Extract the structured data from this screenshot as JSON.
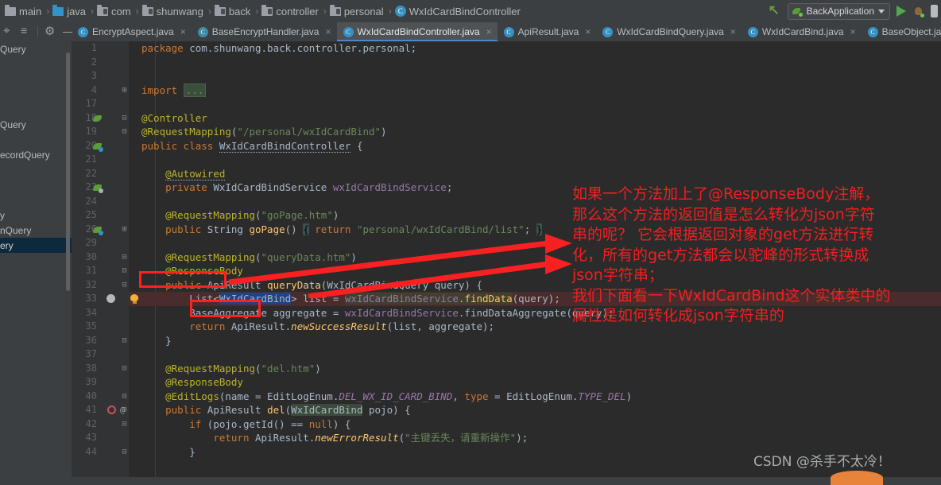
{
  "window": {
    "breadcrumb": [
      {
        "label": "main",
        "icon": "folder-icon"
      },
      {
        "label": "java",
        "icon": "folder-blue-icon"
      },
      {
        "label": "com",
        "icon": "folder-dark-icon"
      },
      {
        "label": "shunwang",
        "icon": "folder-dark-icon"
      },
      {
        "label": "back",
        "icon": "folder-dark-icon"
      },
      {
        "label": "controller",
        "icon": "folder-dark-icon"
      },
      {
        "label": "personal",
        "icon": "folder-dark-icon"
      },
      {
        "label": "WxIdCardBindController",
        "icon": "class-icon"
      }
    ],
    "separator": "›",
    "run_config": {
      "name": "BackApplication",
      "dropdown_glyph": "▼"
    }
  },
  "left_toolbar": {
    "icons": [
      "locate-icon",
      "collapse-all-icon",
      "settings-gear-icon",
      "minimize-icon"
    ]
  },
  "tabs": [
    {
      "label": "EncryptAspect.java",
      "active": false,
      "icon": "class-icon",
      "close": "×"
    },
    {
      "label": "BaseEncryptHandler.java",
      "active": false,
      "icon": "abstract-class-icon",
      "close": "×"
    },
    {
      "label": "WxIdCardBindController.java",
      "active": true,
      "icon": "class-icon",
      "close": "×"
    },
    {
      "label": "ApiResult.java",
      "active": false,
      "icon": "class-icon",
      "close": "×"
    },
    {
      "label": "WxIdCardBindQuery.java",
      "active": false,
      "icon": "class-icon",
      "close": "×"
    },
    {
      "label": "WxIdCardBind.java",
      "active": false,
      "icon": "class-icon",
      "close": "×"
    },
    {
      "label": "BaseObject.java",
      "active": false,
      "icon": "class-icon",
      "close": "×"
    }
  ],
  "project_tree": [
    {
      "label": "Query",
      "selected": false
    },
    {
      "label": "",
      "selected": false
    },
    {
      "label": "",
      "selected": false
    },
    {
      "label": "",
      "selected": false
    },
    {
      "label": "",
      "selected": false
    },
    {
      "label": "Query",
      "selected": false
    },
    {
      "label": "",
      "selected": false
    },
    {
      "label": "ecordQuery",
      "selected": false
    },
    {
      "label": "",
      "selected": false
    },
    {
      "label": "",
      "selected": false
    },
    {
      "label": "",
      "selected": false
    },
    {
      "label": "y",
      "selected": false
    },
    {
      "label": "nQuery",
      "selected": false
    },
    {
      "label": "ery",
      "selected": true
    }
  ],
  "code": {
    "lines": [
      {
        "num": "1",
        "tokens": [
          {
            "t": "package ",
            "c": "kw"
          },
          {
            "t": "com.shunwang.back.controller.personal;",
            "c": "ident"
          }
        ]
      },
      {
        "num": "2",
        "tokens": []
      },
      {
        "num": "3",
        "tokens": []
      },
      {
        "num": "4",
        "tokens": [
          {
            "t": "import ",
            "c": "kw"
          },
          {
            "t": "...",
            "c": "fold-box"
          }
        ],
        "fold": "⊞"
      },
      {
        "num": "17",
        "tokens": []
      },
      {
        "num": "18",
        "tokens": [
          {
            "t": "@Controller",
            "c": "ann"
          }
        ],
        "gutter": "bean",
        "fold": "⊟"
      },
      {
        "num": "19",
        "tokens": [
          {
            "t": "@RequestMapping",
            "c": "ann"
          },
          {
            "t": "(",
            "c": "ident"
          },
          {
            "t": "\"/personal/wxIdCardBind\"",
            "c": "str"
          },
          {
            "t": ")",
            "c": "ident"
          }
        ],
        "fold": "⊟"
      },
      {
        "num": "20",
        "tokens": [
          {
            "t": "public class ",
            "c": "kw"
          },
          {
            "t": "WxIdCardBindController",
            "c": "warn"
          },
          {
            "t": " {",
            "c": "ident"
          }
        ],
        "gutter": "bean-blue"
      },
      {
        "num": "21",
        "tokens": []
      },
      {
        "num": "22",
        "tokens": [
          {
            "t": "    ",
            "c": "ident"
          },
          {
            "t": "@Autowired",
            "c": "ann-warn"
          }
        ]
      },
      {
        "num": "23",
        "tokens": [
          {
            "t": "    ",
            "c": "ident"
          },
          {
            "t": "private ",
            "c": "kw"
          },
          {
            "t": "WxIdCardBindService ",
            "c": "ident"
          },
          {
            "t": "wxIdCardBindService",
            "c": "fld"
          },
          {
            "t": ";",
            "c": "ident"
          }
        ],
        "gutter": "bean-gray"
      },
      {
        "num": "24",
        "tokens": []
      },
      {
        "num": "25",
        "tokens": [
          {
            "t": "    ",
            "c": "ident"
          },
          {
            "t": "@RequestMapping",
            "c": "ann"
          },
          {
            "t": "(",
            "c": "ident"
          },
          {
            "t": "\"goPage.htm\"",
            "c": "str"
          },
          {
            "t": ")",
            "c": "ident"
          }
        ]
      },
      {
        "num": "26",
        "tokens": [
          {
            "t": "    ",
            "c": "ident"
          },
          {
            "t": "public ",
            "c": "kw"
          },
          {
            "t": "String ",
            "c": "ident"
          },
          {
            "t": "goPage",
            "c": "mth"
          },
          {
            "t": "() ",
            "c": "ident"
          },
          {
            "t": "{",
            "c": "brace"
          },
          {
            "t": " ",
            "c": "ident"
          },
          {
            "t": "return ",
            "c": "kw"
          },
          {
            "t": "\"personal/wxIdCardBind/list\"",
            "c": "str"
          },
          {
            "t": "; ",
            "c": "ident"
          },
          {
            "t": "}",
            "c": "brace"
          }
        ],
        "gutter": "bean-blue",
        "fold": "⊞"
      },
      {
        "num": "29",
        "tokens": []
      },
      {
        "num": "30",
        "tokens": [
          {
            "t": "    ",
            "c": "ident"
          },
          {
            "t": "@RequestMapping",
            "c": "ann"
          },
          {
            "t": "(",
            "c": "ident"
          },
          {
            "t": "\"queryData.htm\"",
            "c": "str"
          },
          {
            "t": ")",
            "c": "ident"
          }
        ],
        "fold": "⊟"
      },
      {
        "num": "31",
        "tokens": [
          {
            "t": "    ",
            "c": "ident"
          },
          {
            "t": "@ResponseBody",
            "c": "ann"
          }
        ],
        "fold": "⊟"
      },
      {
        "num": "32",
        "tokens": [
          {
            "t": "    ",
            "c": "ident"
          },
          {
            "t": "public ",
            "c": "kw"
          },
          {
            "t": "ApiResult ",
            "c": "ident"
          },
          {
            "t": "queryData",
            "c": "mth"
          },
          {
            "t": "(WxIdCardBindQuery query) {",
            "c": "ident"
          }
        ],
        "fold": "⊟"
      },
      {
        "num": "33",
        "tokens": [
          {
            "t": "        ",
            "c": "ident"
          },
          {
            "t": "List<",
            "c": "ident"
          },
          {
            "t": "WxIdCardBind",
            "c": "sel"
          },
          {
            "t": "> list = ",
            "c": "ident"
          },
          {
            "t": "wxIdCardBindService",
            "c": "fld-hl"
          },
          {
            "t": ".",
            "c": "ident-hl2"
          },
          {
            "t": "findData",
            "c": "mth-hl"
          },
          {
            "t": "(query);",
            "c": "ident"
          }
        ],
        "error": true,
        "gutter": "breakpoint",
        "bulb": true
      },
      {
        "num": "34",
        "tokens": [
          {
            "t": "        ",
            "c": "ident"
          },
          {
            "t": "BaseAggregate aggregate = ",
            "c": "ident"
          },
          {
            "t": "wxIdCardBindService",
            "c": "fld"
          },
          {
            "t": ".findDataAggregate(query);",
            "c": "ident"
          }
        ]
      },
      {
        "num": "35",
        "tokens": [
          {
            "t": "        ",
            "c": "ident"
          },
          {
            "t": "return ",
            "c": "kw"
          },
          {
            "t": "ApiResult.",
            "c": "ident"
          },
          {
            "t": "newSuccessResult",
            "c": "sta2"
          },
          {
            "t": "(list, aggregate);",
            "c": "ident"
          }
        ]
      },
      {
        "num": "36",
        "tokens": [
          {
            "t": "    }",
            "c": "ident"
          }
        ],
        "fold": "⊟"
      },
      {
        "num": "37",
        "tokens": []
      },
      {
        "num": "38",
        "tokens": [
          {
            "t": "    ",
            "c": "ident"
          },
          {
            "t": "@RequestMapping",
            "c": "ann"
          },
          {
            "t": "(",
            "c": "ident"
          },
          {
            "t": "\"del.htm\"",
            "c": "str"
          },
          {
            "t": ")",
            "c": "ident"
          }
        ],
        "fold": "⊟"
      },
      {
        "num": "39",
        "tokens": [
          {
            "t": "    ",
            "c": "ident"
          },
          {
            "t": "@ResponseBody",
            "c": "ann"
          }
        ]
      },
      {
        "num": "40",
        "tokens": [
          {
            "t": "    ",
            "c": "ident"
          },
          {
            "t": "@EditLogs",
            "c": "ann"
          },
          {
            "t": "(name = EditLogEnum.",
            "c": "ident"
          },
          {
            "t": "DEL_WX_ID_CARD_BIND",
            "c": "stat"
          },
          {
            "t": ", ",
            "c": "ident"
          },
          {
            "t": "type",
            "c": "kw"
          },
          {
            "t": " = EditLogEnum.",
            "c": "ident"
          },
          {
            "t": "TYPE_DEL",
            "c": "stat"
          },
          {
            "t": ")",
            "c": "ident"
          }
        ],
        "fold": "⊟"
      },
      {
        "num": "41",
        "tokens": [
          {
            "t": "    ",
            "c": "ident"
          },
          {
            "t": "public ",
            "c": "kw"
          },
          {
            "t": "ApiResult ",
            "c": "ident"
          },
          {
            "t": "del",
            "c": "mth"
          },
          {
            "t": "(",
            "c": "ident"
          },
          {
            "t": "WxIdCardBind",
            "c": "ident-hl"
          },
          {
            "t": " pojo) {",
            "c": "ident"
          }
        ],
        "gutter": "annotation-marker",
        "at": "@",
        "fold": "⊟"
      },
      {
        "num": "42",
        "tokens": [
          {
            "t": "        ",
            "c": "ident"
          },
          {
            "t": "if ",
            "c": "kw"
          },
          {
            "t": "(pojo.getId() == ",
            "c": "ident"
          },
          {
            "t": "null",
            "c": "kw"
          },
          {
            "t": ") {",
            "c": "ident"
          }
        ],
        "fold": "⊟"
      },
      {
        "num": "43",
        "tokens": [
          {
            "t": "            ",
            "c": "ident"
          },
          {
            "t": "return ",
            "c": "kw"
          },
          {
            "t": "ApiResult.",
            "c": "ident"
          },
          {
            "t": "newErrorResult",
            "c": "sta2"
          },
          {
            "t": "(",
            "c": "ident"
          },
          {
            "t": "\"主键丢失，请重新操作\"",
            "c": "str"
          },
          {
            "t": ");",
            "c": "ident"
          }
        ]
      },
      {
        "num": "44",
        "tokens": [
          {
            "t": "        }",
            "c": "ident"
          }
        ],
        "fold": "⊟"
      }
    ]
  },
  "annotation": {
    "text": "如果一个方法加上了@ResponseBody注解，\n那么这个方法的返回值是怎么转化为json字符\n串的呢？ 它会根据返回对象的get方法进行转\n化，所有的get方法都会以驼峰的形式转换成\njson字符串；\n我们下面看一下WxIdCardBind这个实体类中的\n属性是如何转化成json字符串的",
    "color": "#f02020",
    "boxes": [
      "responsebody-box",
      "wxidcardbind-box"
    ],
    "arrows": 2
  },
  "watermark": {
    "text": "CSDN @杀手不太冷！"
  }
}
